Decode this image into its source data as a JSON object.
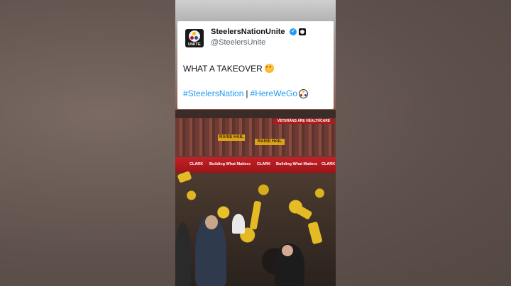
{
  "tweet": {
    "display_name": "SteelersNationUnite",
    "handle": "@SteelersUnite",
    "avatar_text": "UNITE",
    "verified_mark": "✓",
    "text": "WHAT A TAKEOVER",
    "emoji_icon": "star-struck-emoji-icon",
    "hashtags": [
      "#SteelersNation",
      "#HereWeGo"
    ],
    "hashtag_separator": "|",
    "trailing_icon": "steelers-logo-icon"
  },
  "video": {
    "signs": {
      "raise_hail_1": "RAISE HAIL",
      "raise_hail_2": "RAISE HAIL",
      "vet_banner": "VETERANS ARE HEALTHCARE",
      "ribbon_left": "CLARK",
      "ribbon_mid": "Building What Matters",
      "ribbon_mid2": "CLARK",
      "ribbon_right": "Building What Matters",
      "ribbon_far": "CLARK"
    }
  },
  "colors": {
    "link": "#1d9bf0",
    "verified": "#1d9bf0",
    "steelers_gold": "#e4bb25",
    "ribbon_red": "#c32025",
    "background": "#6b5d57"
  }
}
